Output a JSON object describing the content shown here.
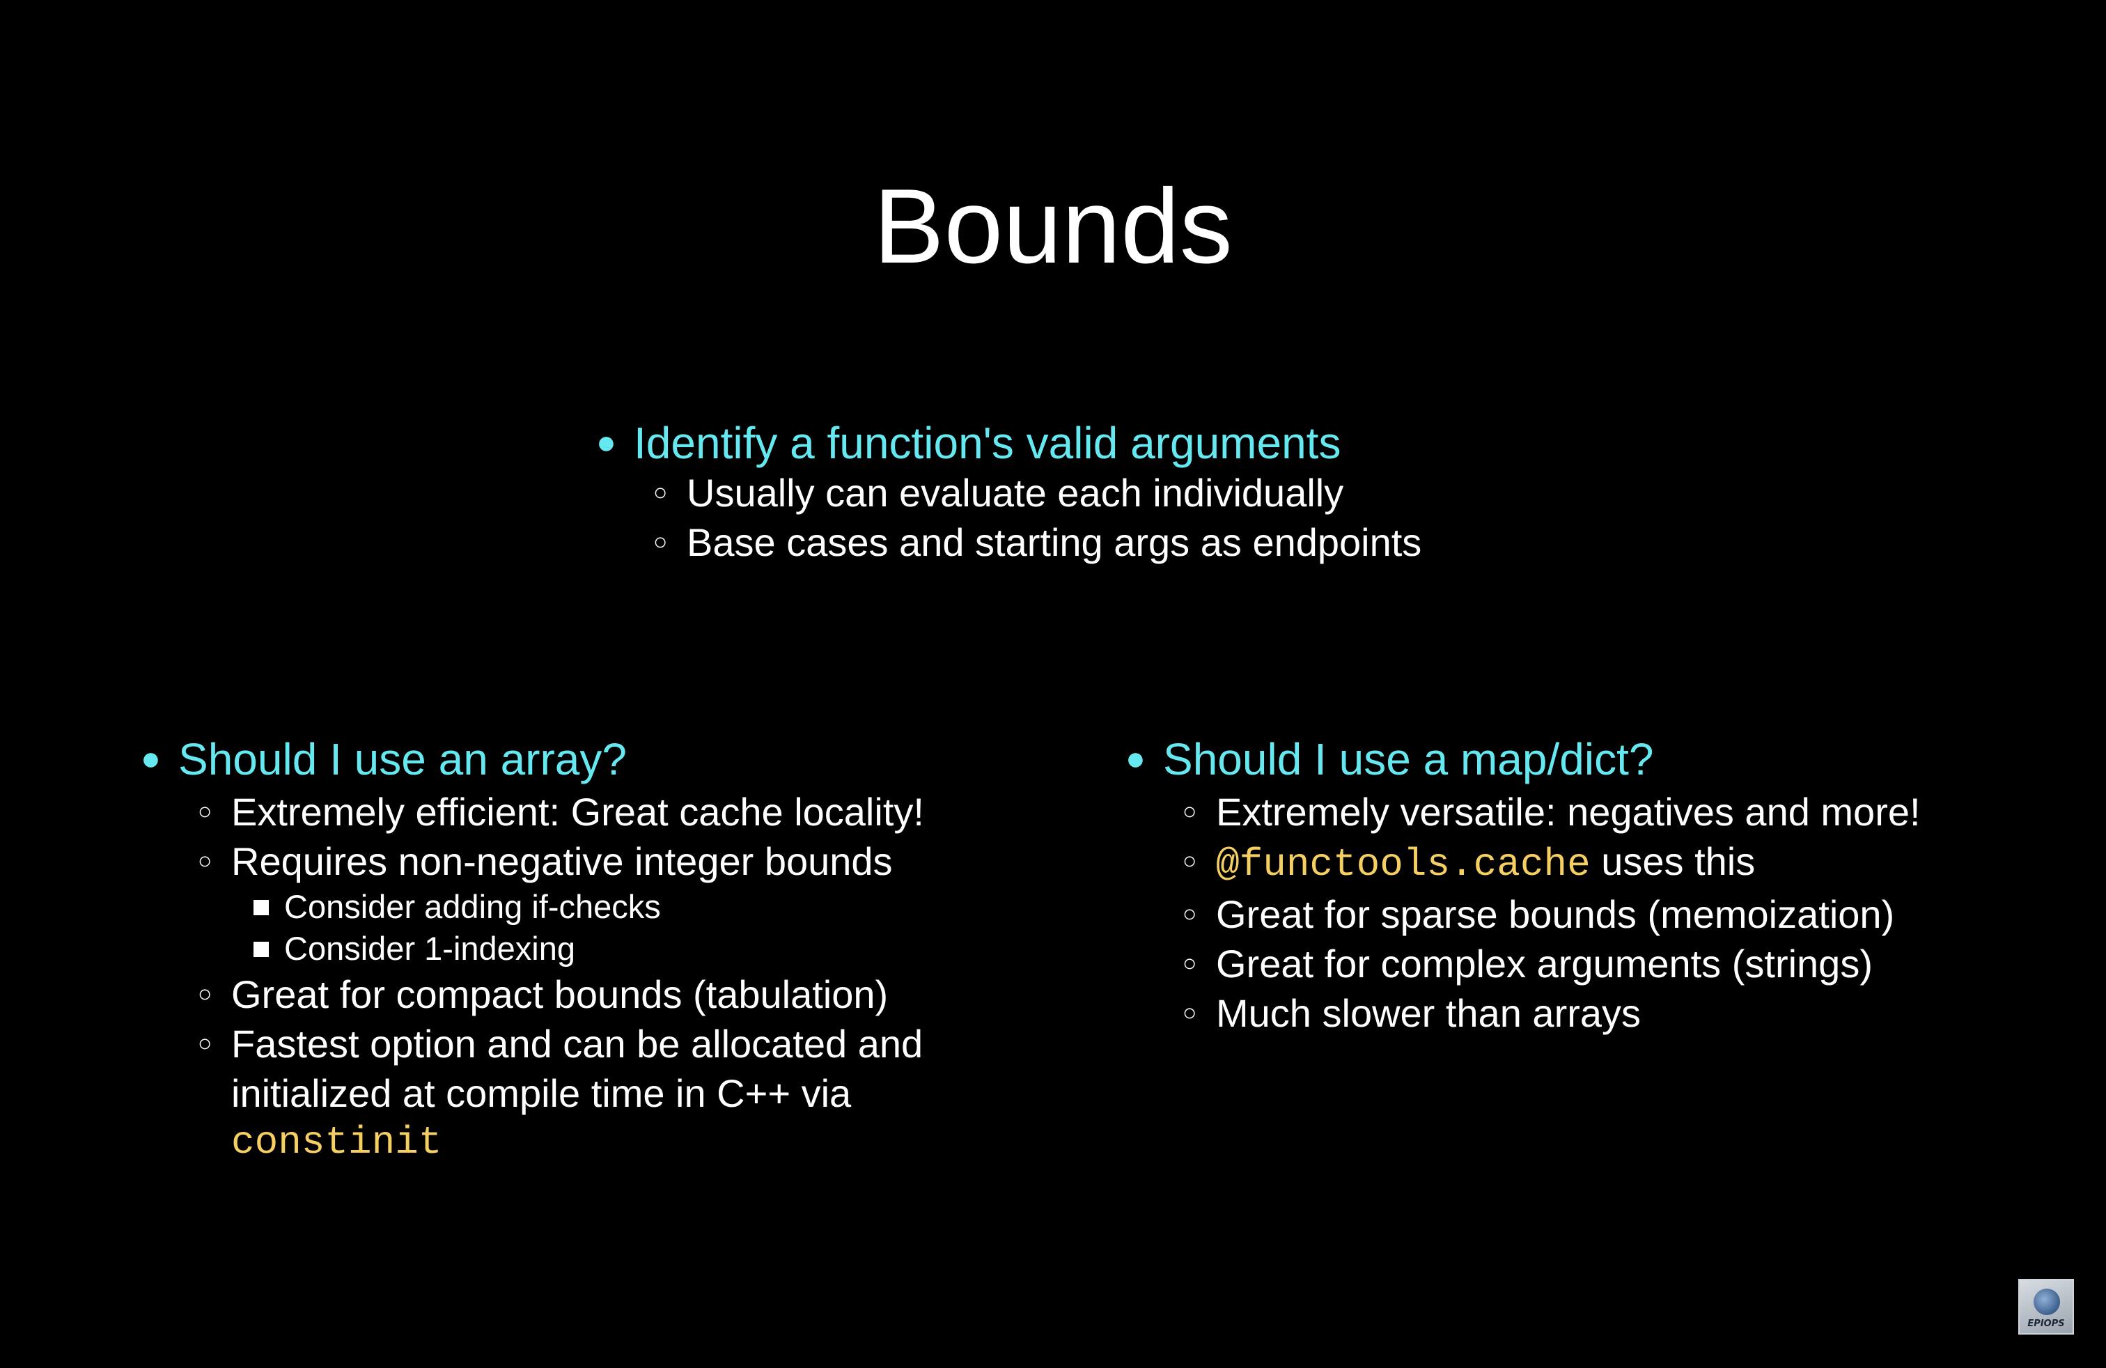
{
  "slide": {
    "title": "Bounds",
    "top": {
      "heading": "Identify a function's valid arguments",
      "items": [
        "Usually can evaluate each individually",
        "Base cases and starting args as endpoints"
      ]
    },
    "left": {
      "heading": "Should I use an array?",
      "item1": "Extremely efficient: Great cache locality!",
      "item2": "Requires non-negative integer bounds",
      "sub": [
        "Consider adding if-checks",
        "Consider 1-indexing"
      ],
      "item3": "Great for compact bounds (tabulation)",
      "item4_line1": "Fastest option and can be allocated and",
      "item4_line2": "initialized at compile time in C++ via",
      "item4_code": "constinit"
    },
    "right": {
      "heading": "Should I use a map/dict?",
      "item1": "Extremely versatile: negatives and more!",
      "item2_code": "@functools.cache",
      "item2_text": " uses this",
      "item3": "Great for sparse bounds (memoization)",
      "item4": "Great for complex arguments (strings)",
      "item5": "Much slower than arrays"
    },
    "logo": {
      "icon": "globe-icon",
      "label": "EPIOPS"
    }
  },
  "colors": {
    "background": "#000000",
    "heading": "#66e8f0",
    "text": "#ffffff",
    "code": "#f5cf62"
  }
}
